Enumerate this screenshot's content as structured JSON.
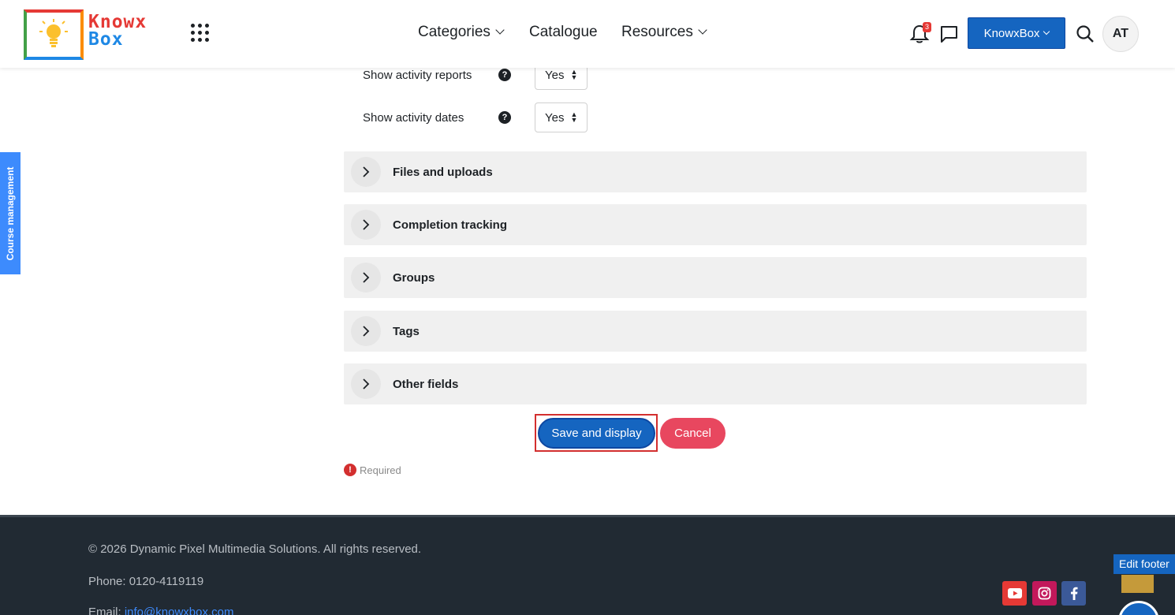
{
  "brand": {
    "line1": "Knowx",
    "line2": "Box"
  },
  "nav": {
    "categories": "Categories",
    "catalogue": "Catalogue",
    "resources": "Resources"
  },
  "header": {
    "notification_count": "3",
    "user_menu": "KnowxBox",
    "avatar": "AT"
  },
  "sidetab": {
    "label": "Course management"
  },
  "form": {
    "rows": [
      {
        "label": "Show activity reports",
        "value": "Yes"
      },
      {
        "label": "Show activity dates",
        "value": "Yes"
      }
    ],
    "sections": [
      "Files and uploads",
      "Completion tracking",
      "Groups",
      "Tags",
      "Other fields"
    ],
    "save_label": "Save and display",
    "cancel_label": "Cancel",
    "required_label": "Required"
  },
  "footer": {
    "copyright": "© 2026 Dynamic Pixel Multimedia Solutions. All rights reserved.",
    "phone": "Phone: 0120-4119119",
    "email_prefix": "Email: ",
    "email": "info@knowxbox.com",
    "edit_label": "Edit footer"
  },
  "colors": {
    "primary": "#1565c0",
    "cancel": "#e8475f",
    "footer_bg": "#212a33",
    "side_tab": "#3d8bfd",
    "youtube": "#e53935",
    "instagram": "#c2185b",
    "facebook": "#3b5998"
  },
  "icons": [
    "apps-grid-icon",
    "bell-icon",
    "chat-icon",
    "search-icon",
    "help-icon",
    "chevron-right-icon",
    "youtube-icon",
    "instagram-icon",
    "facebook-icon"
  ]
}
